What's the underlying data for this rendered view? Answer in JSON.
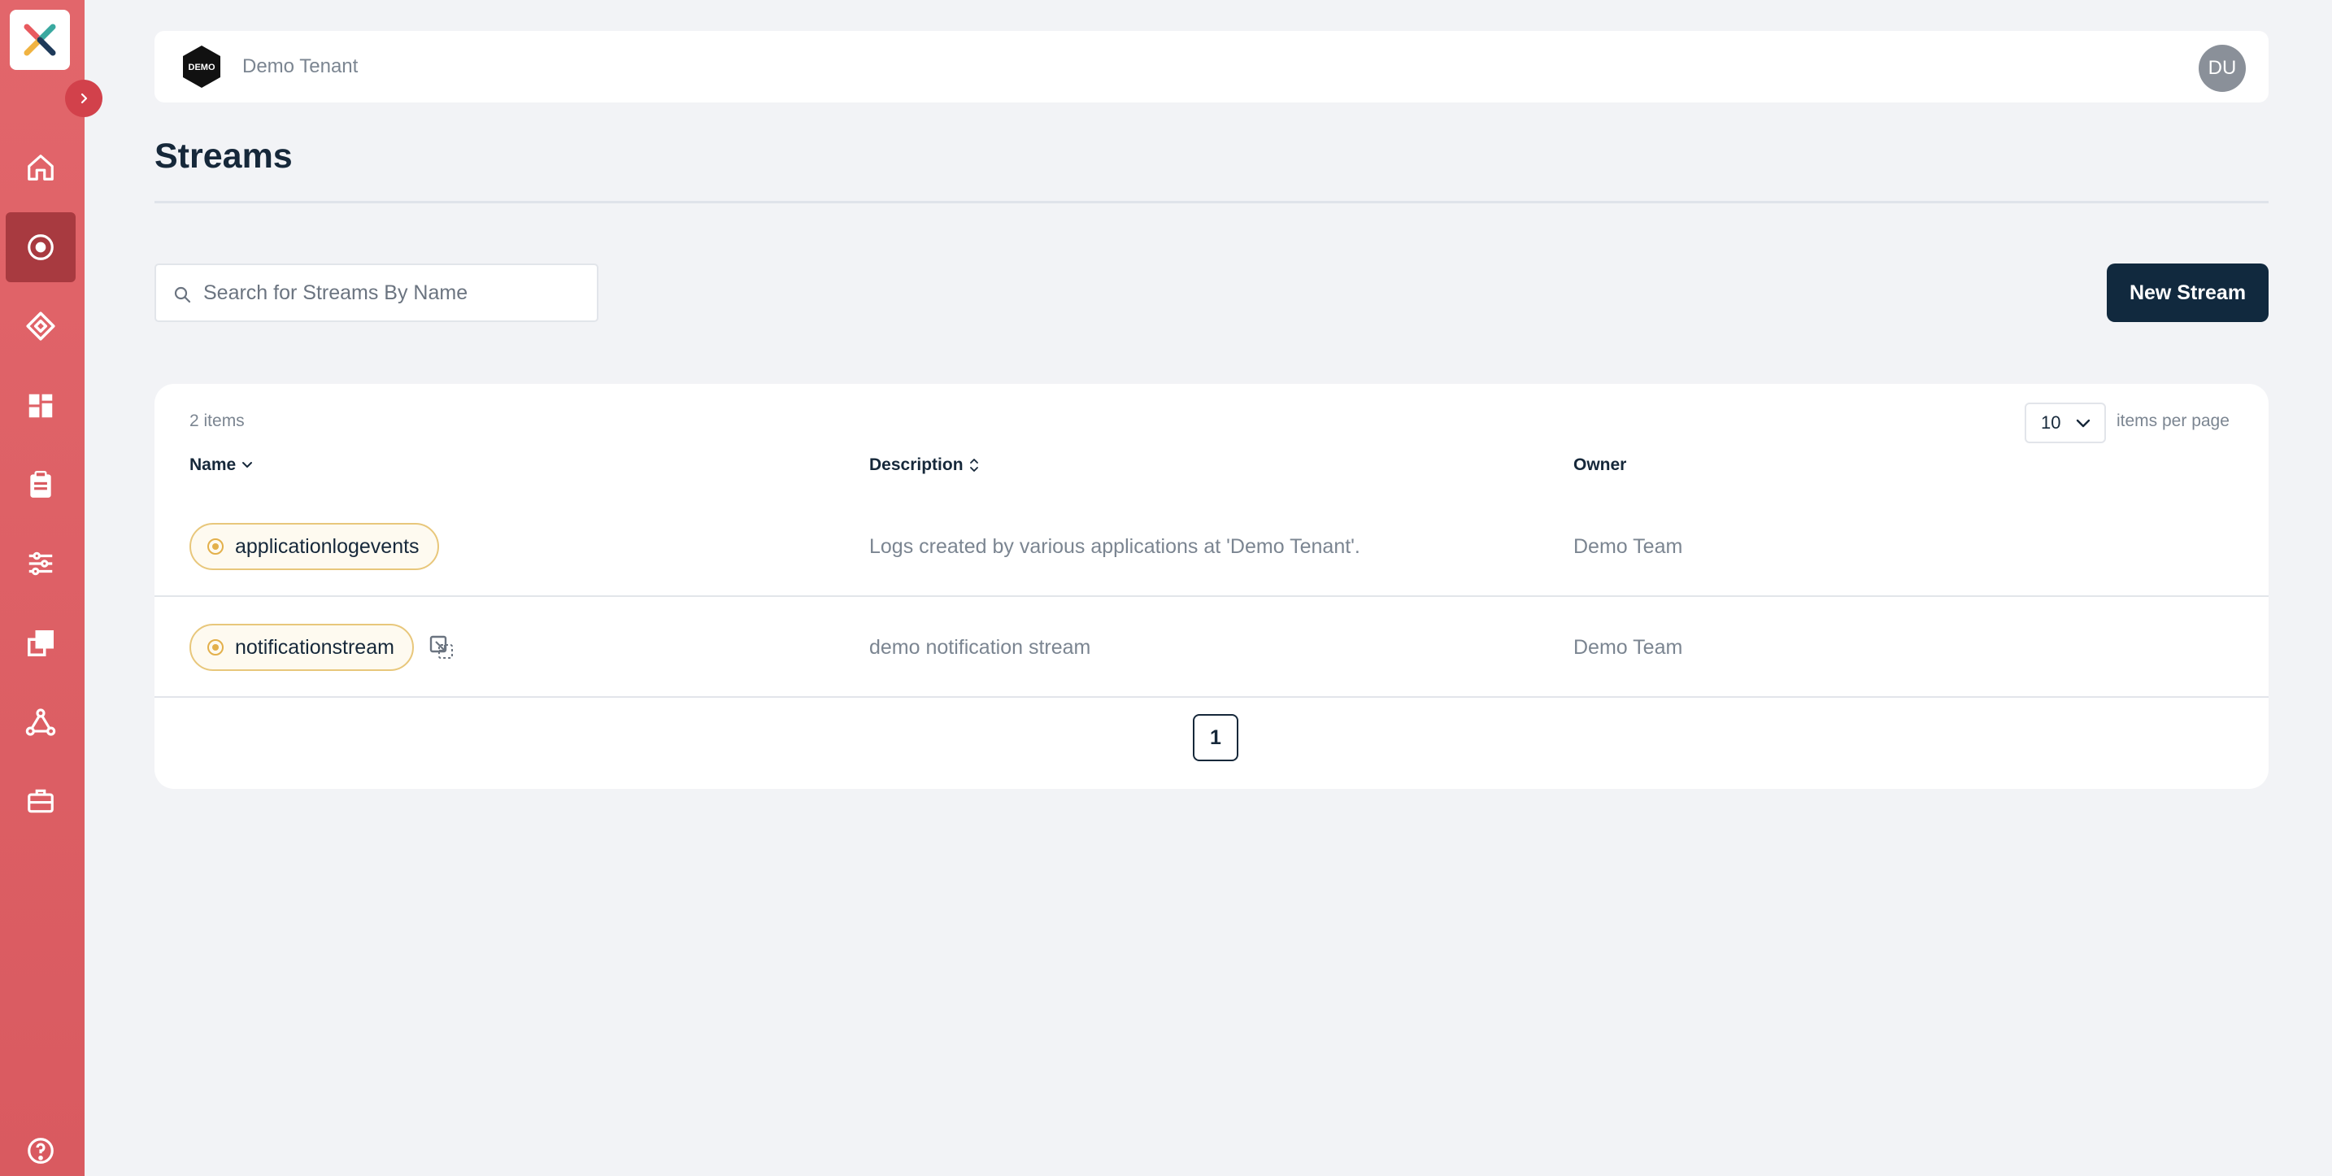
{
  "tenant": {
    "logo_text": "DEMO",
    "name": "Demo Tenant"
  },
  "user": {
    "initials": "DU"
  },
  "page": {
    "title": "Streams"
  },
  "search": {
    "placeholder": "Search for Streams By Name",
    "value": ""
  },
  "actions": {
    "new_stream_label": "New Stream"
  },
  "table": {
    "items_count_label": "2 items",
    "per_page_value": "10",
    "per_page_label": "items per page",
    "columns": {
      "name": "Name",
      "description": "Description",
      "owner": "Owner"
    },
    "rows": [
      {
        "name": "applicationlogevents",
        "description": "Logs created by various applications at 'Demo Tenant'.",
        "owner": "Demo Team",
        "has_link_icon": false
      },
      {
        "name": "notificationstream",
        "description": "demo notification stream",
        "owner": "Demo Team",
        "has_link_icon": true
      }
    ],
    "current_page": "1"
  },
  "sidebar": {
    "items": [
      {
        "icon": "home-icon",
        "active": false
      },
      {
        "icon": "stream-icon",
        "active": true
      },
      {
        "icon": "diamond-icon",
        "active": false
      },
      {
        "icon": "dashboard-icon",
        "active": false
      },
      {
        "icon": "clipboard-icon",
        "active": false
      },
      {
        "icon": "sliders-icon",
        "active": false
      },
      {
        "icon": "copy-icon",
        "active": false
      },
      {
        "icon": "network-icon",
        "active": false
      },
      {
        "icon": "toolbox-icon",
        "active": false
      },
      {
        "icon": "help-icon",
        "active": false
      }
    ]
  },
  "colors": {
    "sidebar": "#e2666b",
    "sidebar_active": "#a83a40",
    "primary_button": "#11293e",
    "chip_border": "#e8c77b",
    "chip_dot": "#e3b04b"
  }
}
